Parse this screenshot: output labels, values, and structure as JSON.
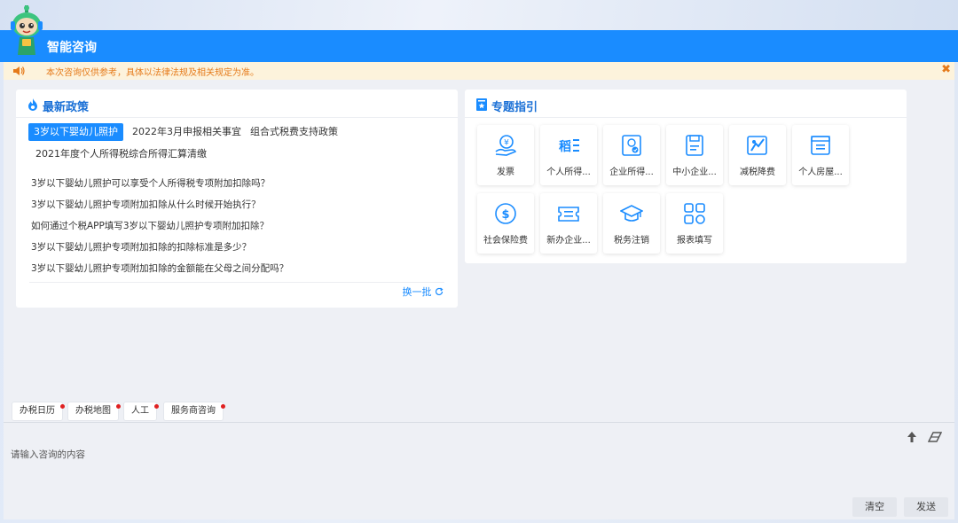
{
  "header": {
    "title": "智能咨询"
  },
  "notice": {
    "text": "本次咨询仅供参考，具体以法律法规及相关规定为准。",
    "close_glyph": "✖"
  },
  "policy": {
    "title": "最新政策",
    "tabs": [
      {
        "label": "3岁以下婴幼儿照护",
        "active": true
      },
      {
        "label": "2022年3月申报相关事宜",
        "active": false
      },
      {
        "label": "组合式税费支持政策",
        "active": false
      },
      {
        "label": "2021年度个人所得税综合所得汇算清缴",
        "active": false
      }
    ],
    "questions": [
      "3岁以下婴幼儿照护可以享受个人所得税专项附加扣除吗？",
      "3岁以下婴幼儿照护专项附加扣除从什么时候开始执行？",
      "如何通过个税APP填写3岁以下婴幼儿照护专项附加扣除？",
      "3岁以下婴幼儿照护专项附加扣除的扣除标准是多少？",
      "3岁以下婴幼儿照护专项附加扣除的金额能在父母之间分配吗？"
    ],
    "refresh_label": "换一批"
  },
  "guide": {
    "title": "专题指引",
    "tiles": [
      {
        "label": "发票",
        "icon": "invoice-icon"
      },
      {
        "label": "个人所得...",
        "icon": "personal-tax-icon"
      },
      {
        "label": "企业所得...",
        "icon": "corporate-tax-icon"
      },
      {
        "label": "中小企业...",
        "icon": "sme-icon"
      },
      {
        "label": "减税降费",
        "icon": "tax-cut-icon"
      },
      {
        "label": "个人房屋...",
        "icon": "housing-icon"
      },
      {
        "label": "社会保险费",
        "icon": "social-insurance-icon"
      },
      {
        "label": "新办企业...",
        "icon": "new-business-icon"
      },
      {
        "label": "税务注销",
        "icon": "deregistration-icon"
      },
      {
        "label": "报表填写",
        "icon": "report-icon"
      }
    ]
  },
  "quick_chips": [
    {
      "label": "办税日历"
    },
    {
      "label": "办税地图"
    },
    {
      "label": "人工"
    },
    {
      "label": "服务商咨询"
    }
  ],
  "input": {
    "placeholder": "请输入咨询的内容"
  },
  "buttons": {
    "clear": "清空",
    "send": "发送"
  },
  "colors": {
    "primary": "#1a8cff",
    "notice_bg": "#fdf3dc",
    "notice_text": "#e57a1a",
    "badge": "#e02020"
  }
}
